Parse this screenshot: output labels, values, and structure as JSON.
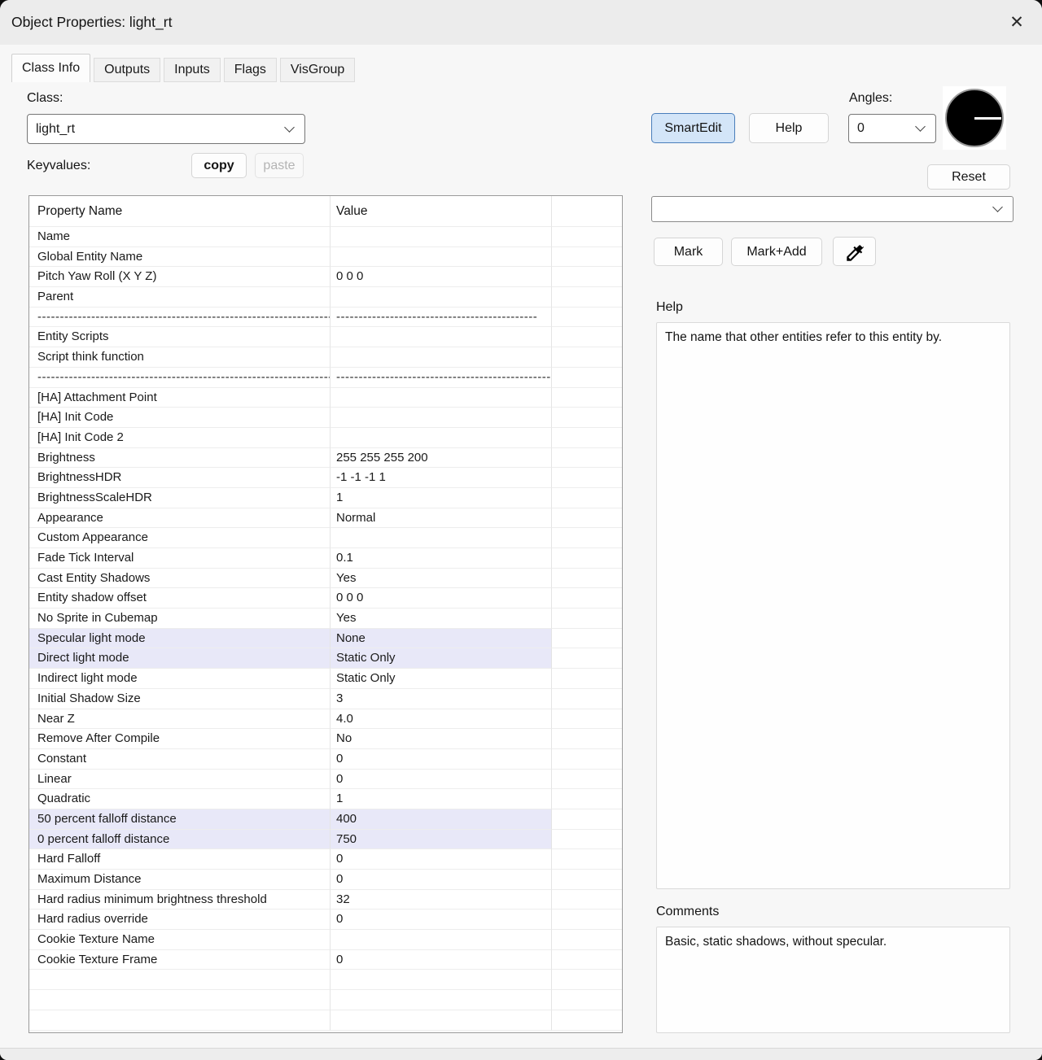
{
  "window": {
    "title": "Object Properties: light_rt"
  },
  "icons": {
    "close": "✕",
    "chevron_down": "chevron-down",
    "eyedropper": "eyedropper",
    "angle_dial": "angle-dial-pointing-right-0-degrees"
  },
  "tabs": [
    {
      "label": "Class Info",
      "active": true
    },
    {
      "label": "Outputs",
      "active": false
    },
    {
      "label": "Inputs",
      "active": false
    },
    {
      "label": "Flags",
      "active": false
    },
    {
      "label": "VisGroup",
      "active": false
    }
  ],
  "class_section": {
    "label": "Class:",
    "selected": "light_rt"
  },
  "keyvalues_section": {
    "label": "Keyvalues:",
    "copy": "copy",
    "paste": "paste"
  },
  "actions": {
    "smartedit": "SmartEdit",
    "help": "Help",
    "reset": "Reset",
    "mark": "Mark",
    "mark_add": "Mark+Add"
  },
  "angles": {
    "label": "Angles:",
    "value": "0"
  },
  "filter_combo": {
    "value": ""
  },
  "help_panel": {
    "title": "Help",
    "text": "The name that other entities refer to this entity by."
  },
  "comments_panel": {
    "title": "Comments",
    "text": "Basic, static shadows, without specular."
  },
  "colors": {
    "titlebar_bg": "#ececec",
    "dialog_bg": "#f7f7f7",
    "accent_button_bg": "#d3e5f8",
    "accent_button_border": "#4a7ebb",
    "row_highlight": "#e8e8f8"
  },
  "property_table": {
    "columns": [
      "Property Name",
      "Value"
    ],
    "rows": [
      {
        "name": "Name",
        "value": ""
      },
      {
        "name": "Global Entity Name",
        "value": ""
      },
      {
        "name": "Pitch Yaw Roll (X Y Z)",
        "value": "0 0 0"
      },
      {
        "name": "Parent",
        "value": ""
      },
      {
        "name": "----------------------------------------------------------------------",
        "value": "---------------------------------------------",
        "separator": true
      },
      {
        "name": "Entity Scripts",
        "value": ""
      },
      {
        "name": "Script think function",
        "value": ""
      },
      {
        "name": "----------------------------------------------------------------------",
        "value": "-------------------------------------------------",
        "separator": true
      },
      {
        "name": "[HA] Attachment Point",
        "value": ""
      },
      {
        "name": "[HA] Init Code",
        "value": ""
      },
      {
        "name": "[HA] Init Code 2",
        "value": ""
      },
      {
        "name": "Brightness",
        "value": "255 255 255 200"
      },
      {
        "name": "BrightnessHDR",
        "value": "-1 -1 -1 1"
      },
      {
        "name": "BrightnessScaleHDR",
        "value": "1"
      },
      {
        "name": "Appearance",
        "value": "Normal"
      },
      {
        "name": "Custom Appearance",
        "value": ""
      },
      {
        "name": "Fade Tick Interval",
        "value": "0.1"
      },
      {
        "name": "Cast Entity Shadows",
        "value": "Yes"
      },
      {
        "name": "Entity shadow offset",
        "value": "0 0 0"
      },
      {
        "name": "No Sprite in Cubemap",
        "value": "Yes"
      },
      {
        "name": "Specular light mode",
        "value": "None",
        "highlight": true
      },
      {
        "name": "Direct light mode",
        "value": "Static Only",
        "highlight": true
      },
      {
        "name": "Indirect light mode",
        "value": "Static Only"
      },
      {
        "name": "Initial Shadow Size",
        "value": "3"
      },
      {
        "name": "Near Z",
        "value": "4.0"
      },
      {
        "name": "Remove After Compile",
        "value": "No"
      },
      {
        "name": "Constant",
        "value": "0"
      },
      {
        "name": "Linear",
        "value": "0"
      },
      {
        "name": "Quadratic",
        "value": "1"
      },
      {
        "name": "50 percent falloff distance",
        "value": "400",
        "highlight": true
      },
      {
        "name": "0 percent falloff distance",
        "value": "750",
        "highlight": true
      },
      {
        "name": "Hard Falloff",
        "value": "0"
      },
      {
        "name": "Maximum Distance",
        "value": "0"
      },
      {
        "name": "Hard radius minimum brightness threshold",
        "value": "32"
      },
      {
        "name": "Hard radius override",
        "value": "0"
      },
      {
        "name": "Cookie Texture Name",
        "value": ""
      },
      {
        "name": "Cookie Texture Frame",
        "value": "0"
      },
      {
        "name": "",
        "value": ""
      },
      {
        "name": "",
        "value": ""
      },
      {
        "name": "",
        "value": ""
      }
    ]
  }
}
